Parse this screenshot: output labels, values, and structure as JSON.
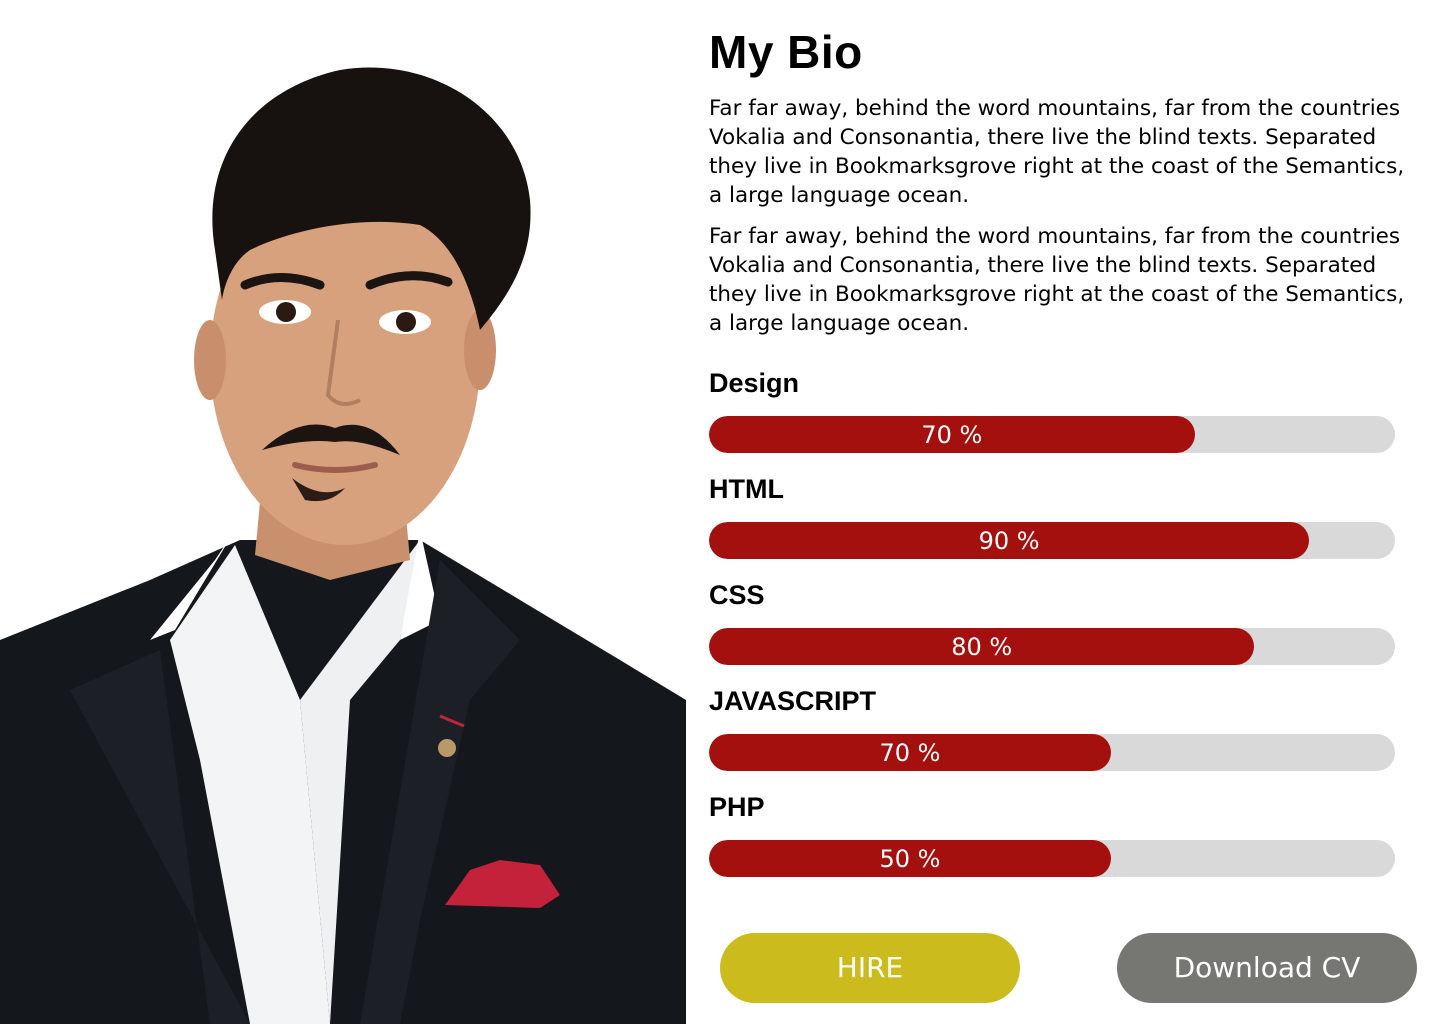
{
  "bio": {
    "title": "My Bio",
    "paragraphs": [
      "Far far away, behind the word mountains, far from the countries Vokalia and Consonantia, there live the blind texts. Separated they live in Bookmarksgrove right at the coast of the Semantics, a large language ocean.",
      "Far far away, behind the word mountains, far from the countries Vokalia and Consonantia, there live the blind texts. Separated they live in Bookmarksgrove right at the coast of the Semantics, a large language ocean."
    ]
  },
  "skills": [
    {
      "name": "Design",
      "percent": 70,
      "label": "70 %"
    },
    {
      "name": "HTML",
      "percent": 90,
      "label": "90 %"
    },
    {
      "name": "CSS",
      "percent": 80,
      "label": "80 %"
    },
    {
      "name": "JAVASCRIPT",
      "percent": 70,
      "label": "70 %"
    },
    {
      "name": "PHP",
      "percent": 50,
      "label": "50 %"
    }
  ],
  "buttons": {
    "hire_label": "HIRE",
    "download_label": "Download CV"
  },
  "colors": {
    "bar_fill": "#a4100e",
    "bar_track": "#d9d9d9",
    "hire_bg": "#cbbb1c",
    "download_bg": "#767673"
  }
}
